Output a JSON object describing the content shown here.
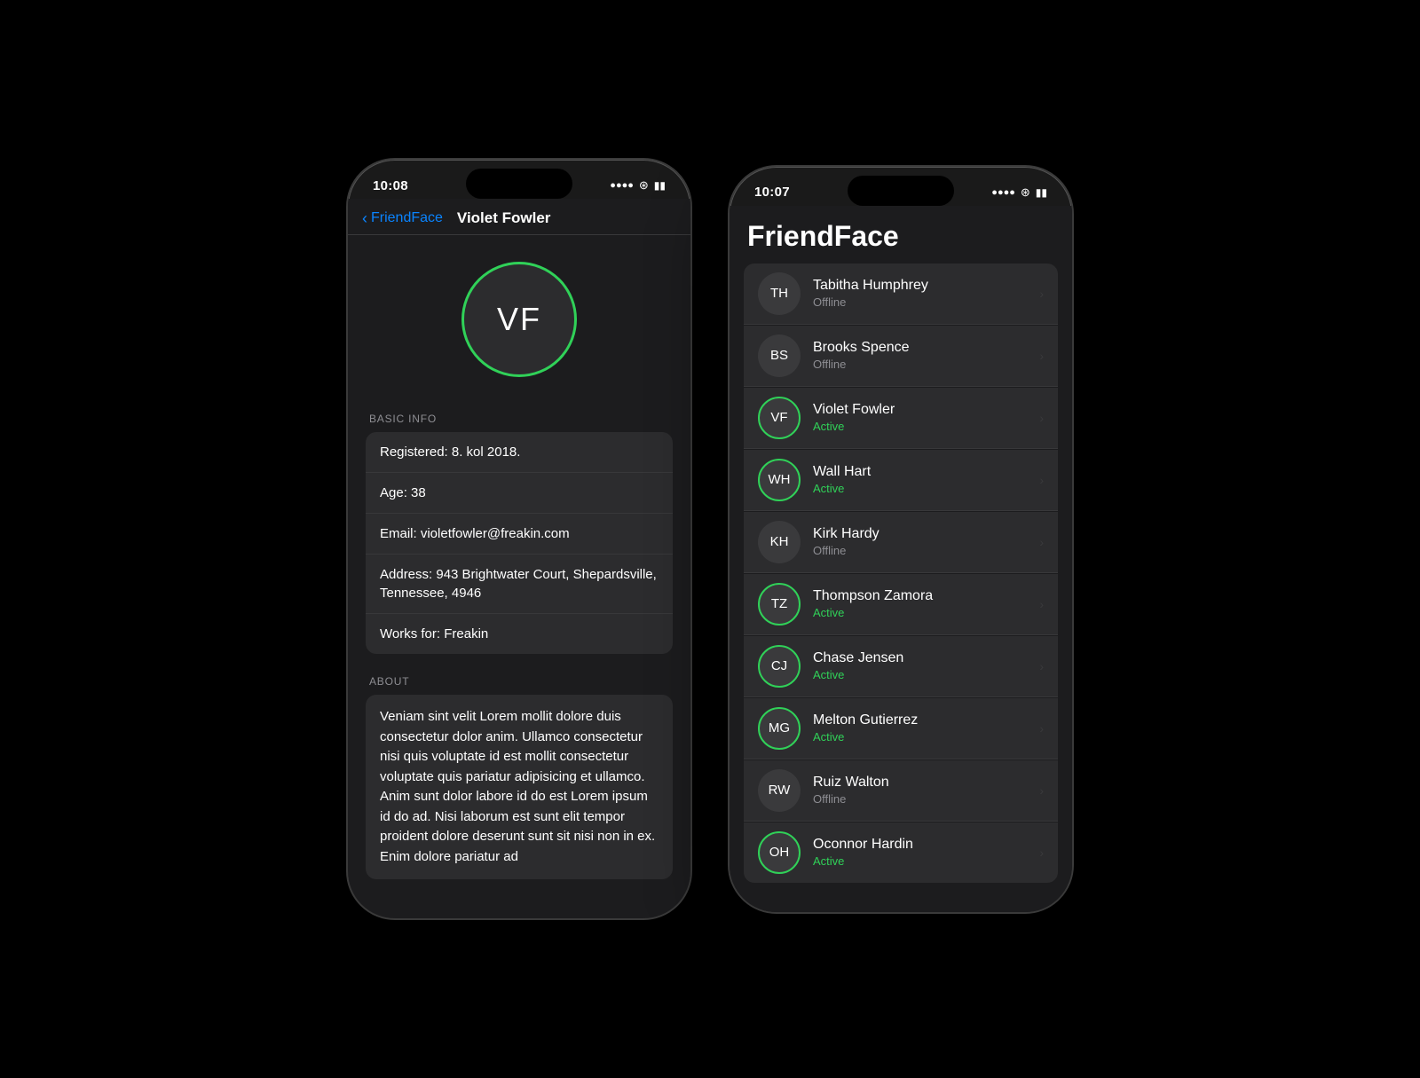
{
  "left_phone": {
    "time": "10:08",
    "nav": {
      "back_label": "FriendFace",
      "title": "Violet Fowler"
    },
    "avatar": {
      "initials": "VF",
      "active": true
    },
    "basic_info_label": "BASIC INFO",
    "basic_info": [
      "Registered: 8. kol 2018.",
      "Age: 38",
      "Email: violetfowler@freakin.com",
      "Address: 943 Brightwater Court, Shepardsville, Tennessee, 4946",
      "Works for: Freakin"
    ],
    "about_label": "ABOUT",
    "about_text": "Veniam sint velit Lorem mollit dolore duis consectetur dolor anim. Ullamco consectetur nisi quis voluptate id est mollit consectetur voluptate quis pariatur adipisicing et ullamco. Anim sunt dolor labore id do est Lorem ipsum id do ad. Nisi laborum est sunt elit tempor proident dolore deserunt sunt sit nisi non in ex. Enim dolore pariatur ad"
  },
  "right_phone": {
    "time": "10:07",
    "title": "FriendFace",
    "friends": [
      {
        "initials": "TH",
        "name": "Tabitha Humphrey",
        "status": "Offline",
        "active": false
      },
      {
        "initials": "BS",
        "name": "Brooks Spence",
        "status": "Offline",
        "active": false
      },
      {
        "initials": "VF",
        "name": "Violet Fowler",
        "status": "Active",
        "active": true
      },
      {
        "initials": "WH",
        "name": "Wall Hart",
        "status": "Active",
        "active": true
      },
      {
        "initials": "KH",
        "name": "Kirk Hardy",
        "status": "Offline",
        "active": false
      },
      {
        "initials": "TZ",
        "name": "Thompson Zamora",
        "status": "Active",
        "active": true
      },
      {
        "initials": "CJ",
        "name": "Chase Jensen",
        "status": "Active",
        "active": true
      },
      {
        "initials": "MG",
        "name": "Melton Gutierrez",
        "status": "Active",
        "active": true
      },
      {
        "initials": "RW",
        "name": "Ruiz Walton",
        "status": "Offline",
        "active": false
      },
      {
        "initials": "OH",
        "name": "Oconnor Hardin",
        "status": "Active",
        "active": true
      }
    ]
  }
}
